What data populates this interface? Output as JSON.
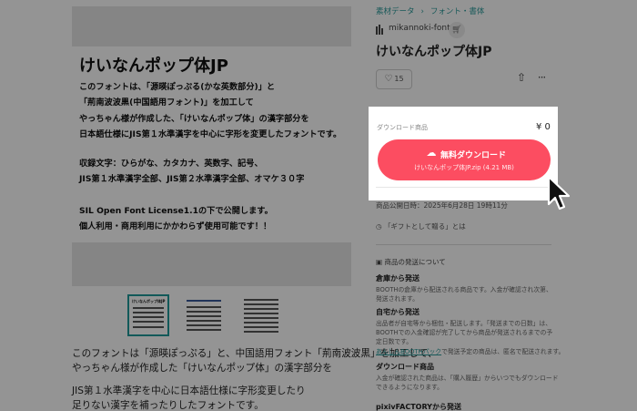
{
  "breadcrumb": {
    "items": [
      "素材データ",
      "フォント・書体"
    ]
  },
  "shop": {
    "name": "mikannoki-font"
  },
  "product": {
    "title": "けいなんポップ体JP",
    "likes": "15"
  },
  "poster": {
    "title": "けいなんポップ体JP",
    "lines": [
      "このフォントは、「源暎ぽっぷる(かな英数部分)」と",
      "「荊南波波黒(中国語用フォント)」を加工して",
      "やっちゃん様が作成した、「けいなんポップ体」の漢字部分を",
      "日本語仕様にJIS第１水準漢字を中心に字形を変更したフォントです。",
      "収録文字：ひらがな、カタカナ、英数字、記号、",
      "JIS第１水準漢字全部、JIS第２水準漢字全部、オマケ３０字",
      "SIL Open Font License1.1の下で公開します。",
      "個人利用・商用利用にかかわらず使用可能です！！"
    ]
  },
  "thumbs": [
    {
      "label": "けいなんポップ体JP"
    },
    {
      "label": ""
    },
    {
      "label": ""
    }
  ],
  "description": {
    "lines": [
      "このフォントは「源暎ぽっぷる」と、中国語用フォント「荊南波波黒」を加工して、",
      "やっちゃん様が作成した「けいなんポップ体」の漢字部分を",
      "JIS第１水準漢字を中心に日本語仕様に字形変更したり",
      "足りない漢字を補ったりしたフォントです。"
    ]
  },
  "purchase": {
    "label": "ダウンロード商品",
    "price": "¥ 0",
    "button_label": "無料ダウンロード",
    "file_name": "けいなんポップ体JP.zip (4.21 MB)"
  },
  "publish": {
    "text": "商品公開日時：2025年6月28日 19時11分"
  },
  "gift": {
    "text": "「ギフトとして贈る」とは"
  },
  "shipping": {
    "title": "商品の発送について",
    "sections": [
      {
        "head": "倉庫から発送",
        "lines": [
          "BOOTHの倉庫から配送される商品です。入金が確認され次第、",
          "発送されます。"
        ]
      },
      {
        "head": "自宅から発送",
        "lines": [
          "出品者が自宅等から梱包・配送します。「発送までの日数」は、",
          "BOOTHでの入金確認が完了してから商品が発送されるまでの予",
          "定日数です。"
        ],
        "link_line": "あんしんBOOTHパック",
        "link_rest": "で発送予定の商品は、匿名で配送されます。"
      },
      {
        "head": "ダウンロード商品",
        "lines": [
          "入金が確認された商品は、「購入履歴」からいつでもダウンロード",
          "できるようになります。"
        ]
      },
      {
        "head": "pixivFACTORYから発送",
        "lines": []
      }
    ]
  },
  "icons": {
    "heart": "heart-icon",
    "share": "share-icon",
    "more": "more-icon",
    "cart": "cart-icon",
    "download": "cloud-download-icon",
    "cursor": "mouse-cursor-icon"
  },
  "colors": {
    "accent": "#fc4d61",
    "link": "#2a9a9a",
    "overlay": "rgba(0,0,0,0.42)"
  }
}
